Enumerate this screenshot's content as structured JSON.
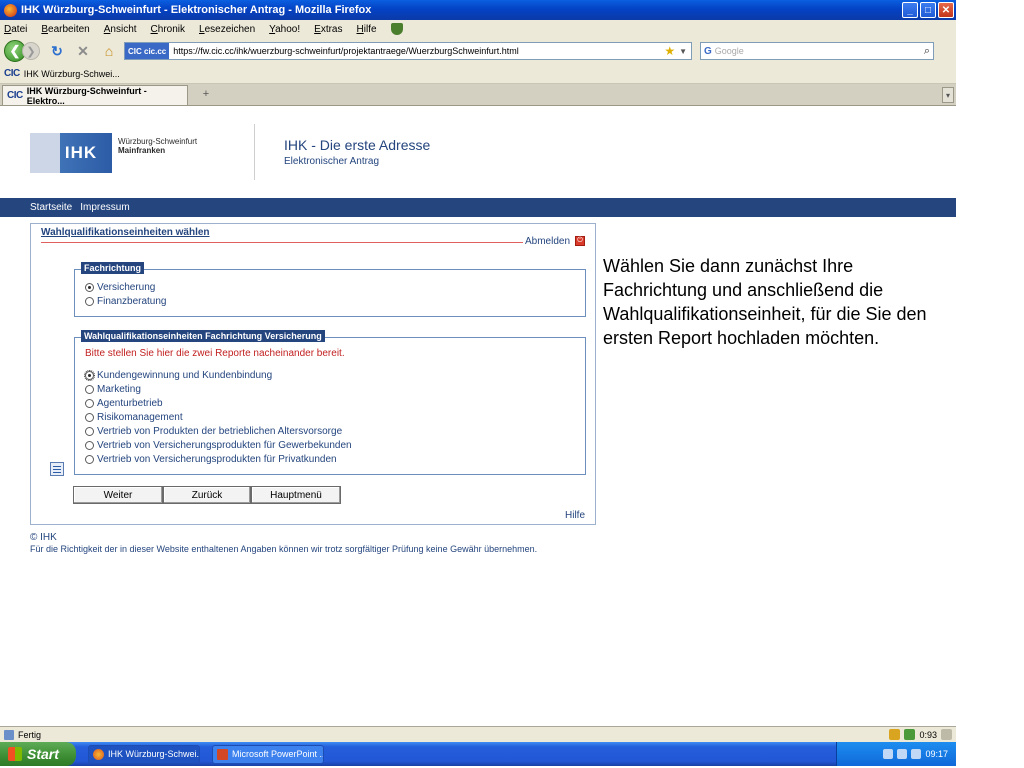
{
  "window": {
    "title": "IHK Würzburg-Schweinfurt - Elektronischer Antrag - Mozilla Firefox"
  },
  "menu": {
    "items": [
      "Datei",
      "Bearbeiten",
      "Ansicht",
      "Chronik",
      "Lesezeichen",
      "Yahoo!",
      "Extras",
      "Hilfe"
    ]
  },
  "nav": {
    "site_badge": "CIC cic.cc",
    "url": "https://fw.cic.cc/ihk/wuerzburg-schweinfurt/projektantraege/WuerzburgSchweinfurt.html",
    "search_placeholder": "Google"
  },
  "bookmarks": {
    "logo": "CIC",
    "item": "IHK Würzburg-Schwei..."
  },
  "tabs": [
    {
      "logo": "CIC",
      "label": "IHK Würzburg-Schweinfurt - Elektro..."
    }
  ],
  "header": {
    "logo_text": "IHK",
    "org_line1": "Würzburg-Schweinfurt",
    "org_line2": "Mainfranken",
    "title": "IHK - Die erste Adresse",
    "subtitle": "Elektronischer Antrag"
  },
  "topnav": {
    "items": [
      "Startseite",
      "Impressum"
    ]
  },
  "form": {
    "title": "Wahlqualifikationseinheiten wählen",
    "logout": "Abmelden",
    "fachrichtung": {
      "legend": "Fachrichtung",
      "options": [
        {
          "label": "Versicherung",
          "selected": true
        },
        {
          "label": "Finanzberatung",
          "selected": false
        }
      ]
    },
    "units": {
      "legend": "Wahlqualifikationseinheiten Fachrichtung Versicherung",
      "hint": "Bitte stellen Sie hier die zwei Reporte nacheinander bereit.",
      "options": [
        {
          "label": "Kundengewinnung und Kundenbindung",
          "selected": true
        },
        {
          "label": "Marketing",
          "selected": false
        },
        {
          "label": "Agenturbetrieb",
          "selected": false
        },
        {
          "label": "Risikomanagement",
          "selected": false
        },
        {
          "label": "Vertrieb von Produkten der betrieblichen Altersvorsorge",
          "selected": false
        },
        {
          "label": "Vertrieb von Versicherungsprodukten für Gewerbekunden",
          "selected": false
        },
        {
          "label": "Vertrieb von Versicherungsprodukten für Privatkunden",
          "selected": false
        }
      ]
    },
    "buttons": {
      "next": "Weiter",
      "back": "Zurück",
      "main": "Hauptmenü"
    },
    "help": "Hilfe"
  },
  "footer": {
    "copyright": "© IHK",
    "disclaimer": "Für die Richtigkeit der in dieser Website enthaltenen Angaben können wir trotz sorgfältiger Prüfung keine Gewähr übernehmen."
  },
  "annotation": {
    "text": "Wählen Sie dann zunächst Ihre Fachrichtung und anschließend die Wahlqualifikationseinheit, für die Sie den ersten Report hochladen möchten."
  },
  "status": {
    "text": "Fertig",
    "counter": "0:93"
  },
  "taskbar": {
    "start": "Start",
    "items": [
      "IHK Würzburg-Schwei...",
      "Microsoft PowerPoint ..."
    ],
    "clock": "09:17"
  }
}
